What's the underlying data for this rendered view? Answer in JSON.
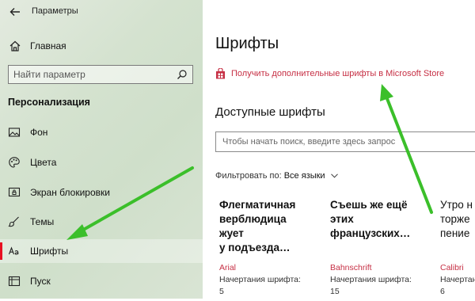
{
  "window": {
    "title": "Параметры"
  },
  "sidebar": {
    "home_label": "Главная",
    "search_placeholder": "Найти параметр",
    "section_title": "Персонализация",
    "items": [
      {
        "label": "Фон",
        "icon": "picture-icon"
      },
      {
        "label": "Цвета",
        "icon": "palette-icon"
      },
      {
        "label": "Экран блокировки",
        "icon": "lock-screen-icon"
      },
      {
        "label": "Темы",
        "icon": "brush-icon"
      },
      {
        "label": "Шрифты",
        "icon": "fonts-icon",
        "active": true
      },
      {
        "label": "Пуск",
        "icon": "start-icon"
      }
    ]
  },
  "main": {
    "title": "Шрифты",
    "store_link": "Получить дополнительные шрифты в Microsoft Store",
    "available_title": "Доступные шрифты",
    "search_placeholder": "Чтобы начать поиск, введите здесь запрос",
    "filter_label": "Фильтровать по:",
    "filter_value": "Все языки",
    "cards": [
      {
        "preview": [
          "Флегматичная",
          "верблюдица",
          "жует",
          "у подъезда…"
        ],
        "name": "Arial",
        "styles_label": "Начертания шрифта:",
        "count": "5"
      },
      {
        "preview": [
          "Съешь же ещё",
          "этих",
          "французских…"
        ],
        "name": "Bahnschrift",
        "styles_label": "Начертания шрифта:",
        "count": "15"
      },
      {
        "preview": [
          "Утро н",
          "торже",
          "пение"
        ],
        "name": "Calibri",
        "styles_label": "Начертания шрифта:",
        "count": "6"
      }
    ]
  },
  "colors": {
    "accent": "#c62f44",
    "active_indicator": "#e81123",
    "annotation_arrow": "#3bbf2a"
  }
}
